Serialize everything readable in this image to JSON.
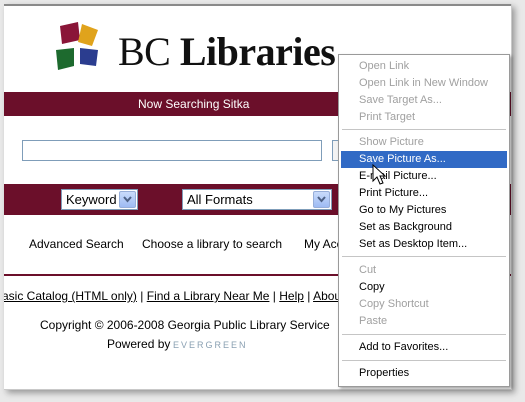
{
  "brand": {
    "name_light": "BC",
    "name_bold": "Libraries"
  },
  "search_bar": {
    "label": "Now Searching Sitka",
    "query_value": ""
  },
  "filters": {
    "search_type": "Keyword",
    "format": "All Formats"
  },
  "nav_links": {
    "advanced_search": "Advanced Search",
    "choose_library": "Choose a library to search",
    "my_account": "My Acc"
  },
  "footer": {
    "basic_catalog": "asic Catalog (HTML only)",
    "sep1": " | ",
    "find_library": "Find a Library Near Me",
    "sep2": " | ",
    "help": "Help",
    "sep3": " | ",
    "about": "About",
    "copyright": "Copyright © 2006-2008 Georgia Public Library Service",
    "powered_by": "Powered by",
    "evergreen": "EVERGREEN"
  },
  "context_menu": {
    "items": [
      {
        "label": "Open Link",
        "enabled": false
      },
      {
        "label": "Open Link in New Window",
        "enabled": false
      },
      {
        "label": "Save Target As...",
        "enabled": false
      },
      {
        "label": "Print Target",
        "enabled": false
      },
      {
        "label": "Show Picture",
        "enabled": false
      },
      {
        "label": "Save Picture As...",
        "enabled": true,
        "highlighted": true
      },
      {
        "label": "E-mail Picture...",
        "enabled": true
      },
      {
        "label": "Print Picture...",
        "enabled": true
      },
      {
        "label": "Go to My Pictures",
        "enabled": true
      },
      {
        "label": "Set as Background",
        "enabled": true
      },
      {
        "label": "Set as Desktop Item...",
        "enabled": true
      },
      {
        "label": "Cut",
        "enabled": false
      },
      {
        "label": "Copy",
        "enabled": true
      },
      {
        "label": "Copy Shortcut",
        "enabled": false
      },
      {
        "label": "Paste",
        "enabled": false
      },
      {
        "label": "Add to Favorites...",
        "enabled": true
      },
      {
        "label": "Properties",
        "enabled": true
      }
    ]
  },
  "colors": {
    "maroon": "#6b0f2a",
    "menu_highlight": "#316ac5"
  }
}
